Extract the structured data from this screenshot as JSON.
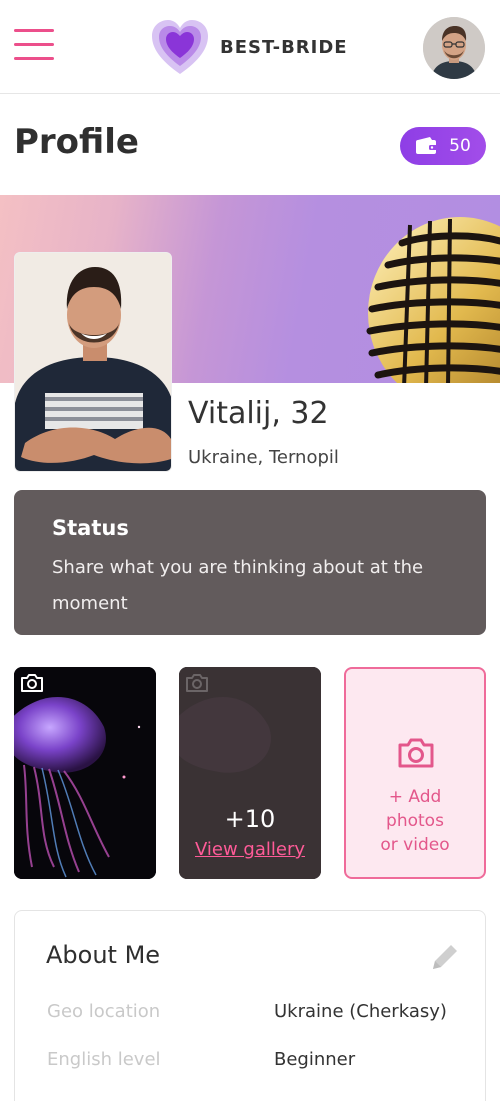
{
  "header": {
    "brand": "BEST-BRIDE",
    "menu_icon": "hamburger-menu-icon",
    "logo_icon": "heart-logo-icon",
    "avatar": "user-avatar"
  },
  "profile": {
    "title": "Profile",
    "coins": "50",
    "coins_icon": "wallet-icon",
    "name_age": "Vitalij, 32",
    "location": "Ukraine, Ternopil"
  },
  "status": {
    "title": "Status",
    "text": "Share what you are thinking about at the moment"
  },
  "gallery": {
    "more_count": "+10",
    "view_label": "View gallery",
    "add_line1": "+ Add",
    "add_line2": "photos",
    "add_line3": "or video"
  },
  "about": {
    "title": "About Me",
    "rows": [
      {
        "label": "Geo location",
        "value": "Ukraine (Cherkasy)"
      },
      {
        "label": "English level",
        "value": "Beginner"
      }
    ]
  },
  "colors": {
    "accent_pink": "#ec4f8b",
    "accent_purple": "#8e3ee6",
    "status_bg": "#625b5c"
  }
}
